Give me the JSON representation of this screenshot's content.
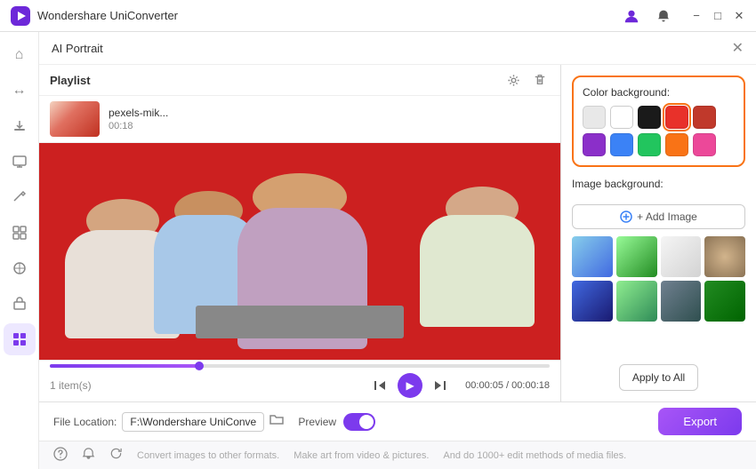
{
  "app": {
    "title": "Wondershare UniConverter",
    "logo_icon": "▶"
  },
  "titlebar": {
    "title": "Wondershare UniConverter",
    "user_icon": "👤",
    "bell_icon": "🔔",
    "minimize_icon": "−",
    "maximize_icon": "□",
    "close_icon": "✕"
  },
  "panel": {
    "title": "AI Portrait",
    "close_icon": "✕"
  },
  "playlist": {
    "title": "Playlist",
    "settings_icon": "⚙",
    "delete_icon": "🗑",
    "items": [
      {
        "filename": "pexels-mik...",
        "duration": "00:18"
      }
    ]
  },
  "video": {
    "current_time": "00:00:05",
    "total_time": "00:00:18",
    "items_count": "1 item(s)"
  },
  "controls": {
    "prev_icon": "⏮",
    "play_icon": "▶",
    "next_icon": "⏭"
  },
  "color_background": {
    "label": "Color background:",
    "colors": [
      {
        "name": "light-gray",
        "hex": "#e8e8e8"
      },
      {
        "name": "white",
        "hex": "#ffffff"
      },
      {
        "name": "black",
        "hex": "#1a1a1a"
      },
      {
        "name": "red",
        "hex": "#e8312a"
      },
      {
        "name": "dark-red",
        "hex": "#c0392b"
      },
      {
        "name": "purple",
        "hex": "#8b2fc9"
      },
      {
        "name": "blue",
        "hex": "#3b82f6"
      },
      {
        "name": "green",
        "hex": "#22c55e"
      },
      {
        "name": "orange",
        "hex": "#f97316"
      },
      {
        "name": "pink",
        "hex": "#ec4899"
      }
    ],
    "selected": "red"
  },
  "image_background": {
    "label": "Image background:",
    "add_button_label": "+ Add Image",
    "images": [
      {
        "id": "img1",
        "class": "img-t1",
        "alt": "beach"
      },
      {
        "id": "img2",
        "class": "img-t2",
        "alt": "forest"
      },
      {
        "id": "img3",
        "class": "img-t3",
        "alt": "white room"
      },
      {
        "id": "img4",
        "class": "img-t4",
        "alt": "wood"
      },
      {
        "id": "img5",
        "class": "img-t5",
        "alt": "night"
      },
      {
        "id": "img6",
        "class": "img-t6",
        "alt": "garden"
      },
      {
        "id": "img7",
        "class": "img-t7",
        "alt": "gray"
      },
      {
        "id": "img8",
        "class": "img-t8",
        "alt": "green"
      }
    ]
  },
  "apply_button": {
    "label": "Apply to All"
  },
  "bottom_bar": {
    "file_location_label": "File Location:",
    "file_path": "F:\\Wondershare UniConverter",
    "preview_label": "Preview",
    "export_label": "Export"
  },
  "footer": {
    "help_icon": "?",
    "bell_icon": "🔔",
    "refresh_icon": "🔄",
    "texts": [
      "Convert images to other formats.",
      "Make art from video & pictures.",
      "And do 1000+ edit methods of media files."
    ]
  },
  "sidebar": {
    "items": [
      {
        "name": "home",
        "icon": "⌂",
        "active": false
      },
      {
        "name": "convert",
        "icon": "↔",
        "active": false
      },
      {
        "name": "download",
        "icon": "⬇",
        "active": false
      },
      {
        "name": "screen",
        "icon": "📺",
        "active": false
      },
      {
        "name": "edit",
        "icon": "✂",
        "active": false
      },
      {
        "name": "merge",
        "icon": "⊞",
        "active": false
      },
      {
        "name": "effects",
        "icon": "⬛",
        "active": false
      },
      {
        "name": "toolbox",
        "icon": "⚙",
        "active": false
      },
      {
        "name": "toolkit",
        "icon": "⊞",
        "active": true
      }
    ]
  }
}
